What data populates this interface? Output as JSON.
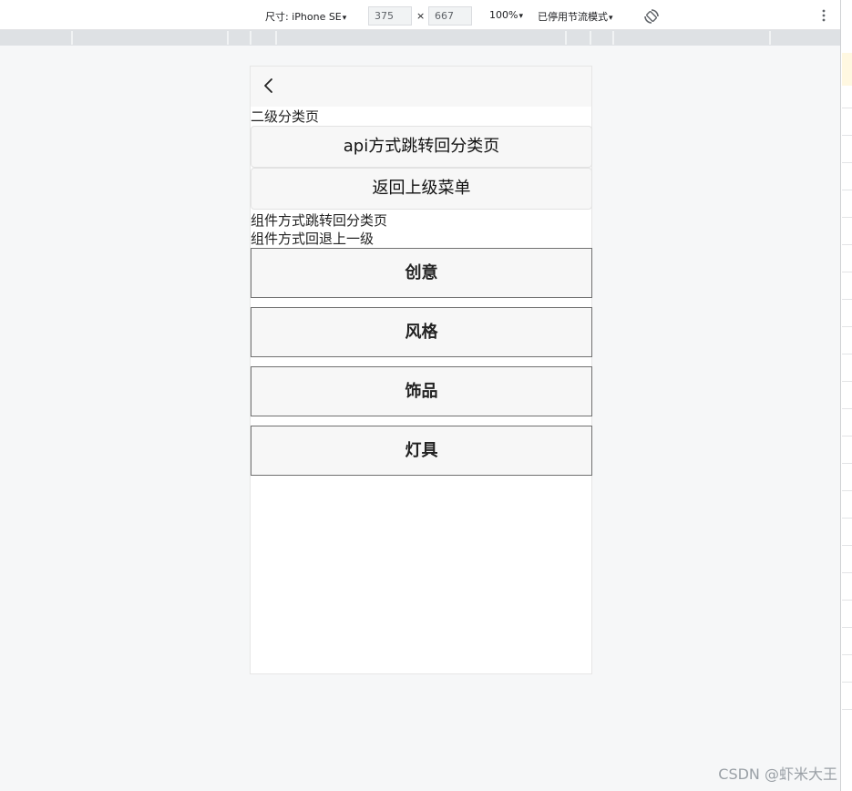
{
  "devtools": {
    "device_label": "尺寸: iPhone SE",
    "width": "375",
    "times": "×",
    "height": "667",
    "zoom": "100%",
    "throttle": "已停用节流模式",
    "caret": "▾"
  },
  "page": {
    "title": "二级分类页",
    "api_button": "api方式跳转回分类页",
    "back_button": "返回上级菜单",
    "component_link_1": "组件方式跳转回分类页",
    "component_link_2": "组件方式回退上一级",
    "categories": [
      "创意",
      "风格",
      "饰品",
      "灯具"
    ]
  },
  "watermark": "CSDN @虾米大王",
  "colors": {
    "nav_bar": "#f7f7f7",
    "category_border": "#707070",
    "background": "#f6f7f8"
  }
}
